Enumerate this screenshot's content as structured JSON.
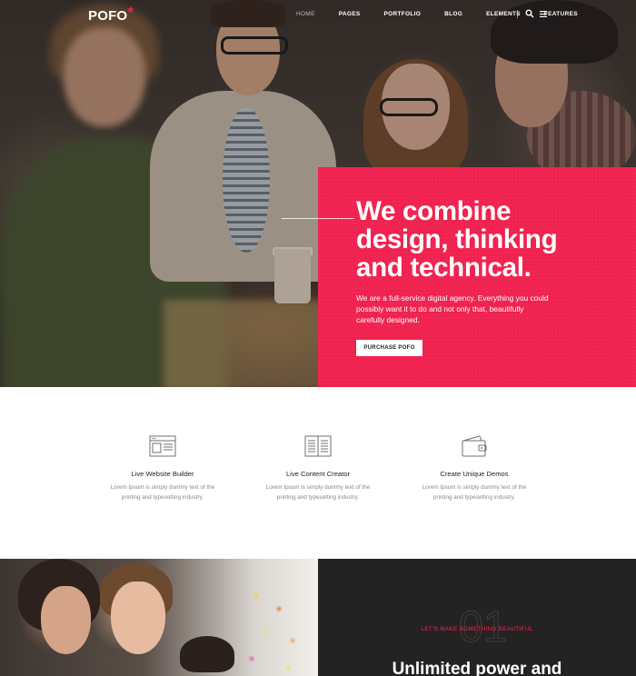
{
  "brand": {
    "logo_text": "POFO",
    "logo_star": "*",
    "accent": "#ff214f"
  },
  "nav": {
    "links": [
      "HOME",
      "PAGES",
      "PORTFOLIO",
      "BLOG",
      "ELEMENTS",
      "FEATURES"
    ],
    "active": "HOME",
    "icons": [
      "search-icon",
      "menu-icon"
    ]
  },
  "hero": {
    "title_lines": [
      "We combine",
      "design, thinking",
      "and technical."
    ],
    "description": "We are a full-service digital agency. Everything you could possibly want it to do and not only that, beautifully carefully designed.",
    "button_label": "PURCHASE POFO",
    "box_color": "#f0224f"
  },
  "features": [
    {
      "icon": "browser-window-icon",
      "title": "Live Website Builder",
      "text": "Lorem Ipsum is simply dummy text of the printing and typesetting industry."
    },
    {
      "icon": "open-book-icon",
      "title": "Live Content Creator",
      "text": "Lorem Ipsum is simply dummy text of the printing and typesetting industry."
    },
    {
      "icon": "wallet-icon",
      "title": "Create Unique Demos",
      "text": "Lorem Ipsum is simply dummy text of the printing and typesetting industry."
    }
  ],
  "bottom": {
    "number": "01",
    "eyebrow": "LET'S MAKE SOMETHING BEAUTIFUL",
    "title": "Unlimited power and"
  }
}
